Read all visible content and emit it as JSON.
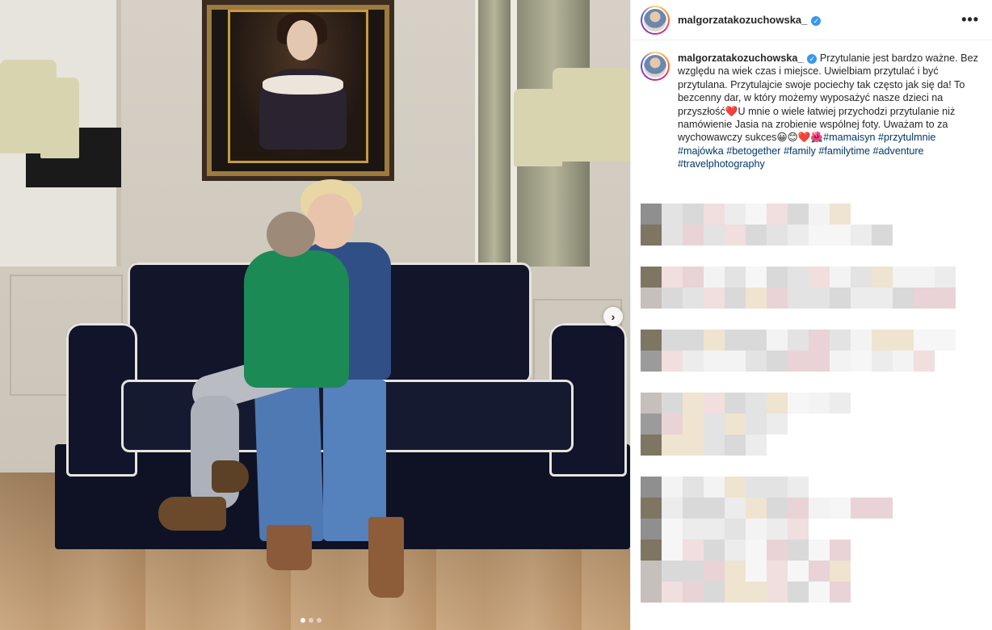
{
  "post": {
    "username": "malgorzatakozuchowska_",
    "verified": true,
    "more_label": "•••",
    "caption": {
      "text_before_heart": "Przytulanie jest bardzo ważne. Bez względu na wiek czas i miejsce. Uwielbiam przytulać i być przytulana. Przytulajcie swoje pociechy tak często jak się da! To bezcenny dar, w który możemy wyposażyć nasze dzieci na przyszłość",
      "heart_1": "❤️",
      "text_after_heart": "U mnie o wiele łatwiej przychodzi przytulanie niż namówienie Jasia na zrobienie wspólnej foty. Uważam to za wychowawczy sukces",
      "emojis": "😀😊❤️🌺",
      "hashtags": [
        "#mamaisyn",
        "#przytulmnie",
        "#majówka",
        "#betogether",
        "#family",
        "#familytime",
        "#adventure",
        "#travelphotography"
      ]
    }
  },
  "carousel": {
    "next_label": "›",
    "slide_count": 3,
    "active_slide": 1
  },
  "colors": {
    "link": "#00376b",
    "verified": "#3897f0",
    "text": "#262626"
  }
}
